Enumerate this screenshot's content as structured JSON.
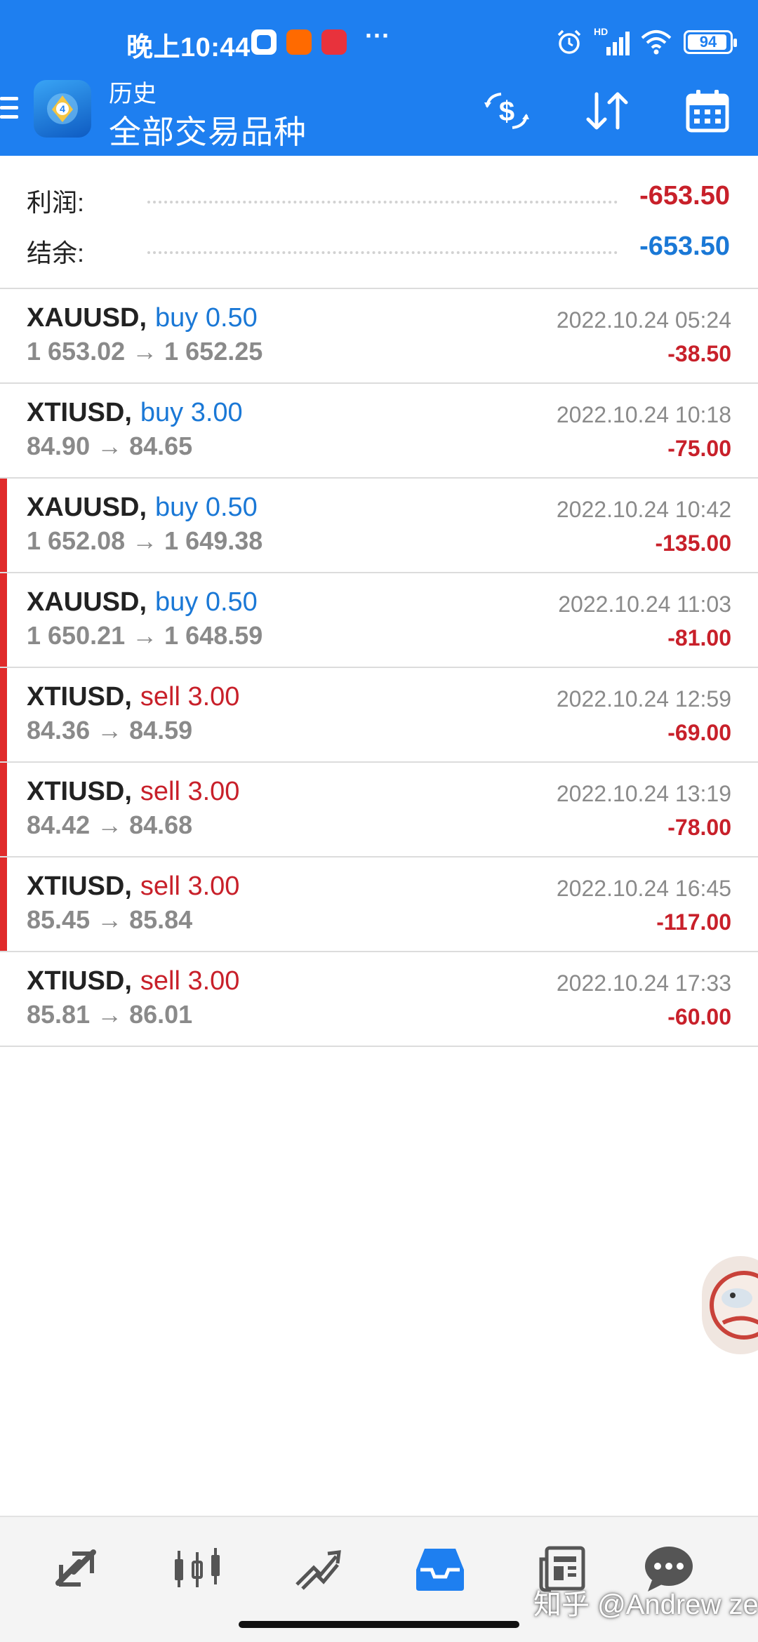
{
  "status_bar": {
    "time": "晚上10:44",
    "battery": "94",
    "network": "HD"
  },
  "header": {
    "subtitle": "历史",
    "title": "全部交易品种"
  },
  "summary": {
    "profit_label": "利润:",
    "profit_value": "-653.50",
    "balance_label": "结余:",
    "balance_value": "-653.50"
  },
  "trades": [
    {
      "symbol": "XAUUSD,",
      "direction": "buy 0.50",
      "type": "buy",
      "price": "1 653.02 → 1 652.25",
      "time": "2022.10.24 05:24",
      "profit": "-38.50",
      "marker": false
    },
    {
      "symbol": "XTIUSD,",
      "direction": "buy 3.00",
      "type": "buy",
      "price": "84.90 → 84.65",
      "time": "2022.10.24 10:18",
      "profit": "-75.00",
      "marker": false
    },
    {
      "symbol": "XAUUSD,",
      "direction": "buy 0.50",
      "type": "buy",
      "price": "1 652.08 → 1 649.38",
      "time": "2022.10.24 10:42",
      "profit": "-135.00",
      "marker": true
    },
    {
      "symbol": "XAUUSD,",
      "direction": "buy 0.50",
      "type": "buy",
      "price": "1 650.21 → 1 648.59",
      "time": "2022.10.24 11:03",
      "profit": "-81.00",
      "marker": true
    },
    {
      "symbol": "XTIUSD,",
      "direction": "sell 3.00",
      "type": "sell",
      "price": "84.36 → 84.59",
      "time": "2022.10.24 12:59",
      "profit": "-69.00",
      "marker": true
    },
    {
      "symbol": "XTIUSD,",
      "direction": "sell 3.00",
      "type": "sell",
      "price": "84.42 → 84.68",
      "time": "2022.10.24 13:19",
      "profit": "-78.00",
      "marker": true
    },
    {
      "symbol": "XTIUSD,",
      "direction": "sell 3.00",
      "type": "sell",
      "price": "85.45 → 85.84",
      "time": "2022.10.24 16:45",
      "profit": "-117.00",
      "marker": true
    },
    {
      "symbol": "XTIUSD,",
      "direction": "sell 3.00",
      "type": "sell",
      "price": "85.81 → 86.01",
      "time": "2022.10.24 17:33",
      "profit": "-60.00",
      "marker": false
    }
  ],
  "bottom_nav": [
    {
      "name": "quotes-icon"
    },
    {
      "name": "chart-icon"
    },
    {
      "name": "trade-icon"
    },
    {
      "name": "history-icon",
      "active": true
    },
    {
      "name": "news-icon"
    },
    {
      "name": "messages-icon"
    }
  ],
  "watermark": "知乎 @Andrew zeng",
  "colors": {
    "header_bg": "#1e7ff0",
    "buy": "#1a78d6",
    "sell": "#c8202a",
    "loss": "#c8202a",
    "balance": "#1a78d6",
    "nav_active": "#1e7ff0",
    "nav_inactive": "#555555"
  }
}
